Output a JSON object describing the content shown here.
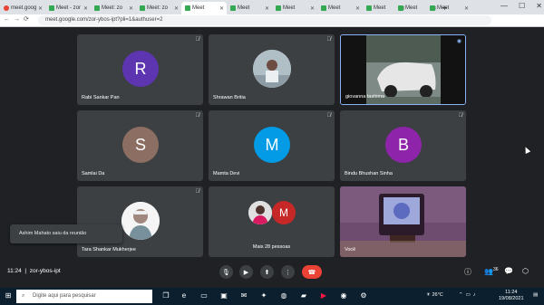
{
  "browser": {
    "tabs": [
      {
        "label": "meet.goog"
      },
      {
        "label": "Meet - zor"
      },
      {
        "label": "Meet: zo"
      },
      {
        "label": "Meet: zo"
      },
      {
        "label": "Meet"
      },
      {
        "label": "Meet"
      },
      {
        "label": "Meet"
      },
      {
        "label": "Meet"
      },
      {
        "label": "Meet"
      },
      {
        "label": "Meet"
      },
      {
        "label": "Meet"
      }
    ],
    "new_tab": "+",
    "url": "meet.google.com/zor-ybos-ipt?pli=1&authuser=2"
  },
  "participants": [
    {
      "name": "Rabi Sankar Pan",
      "initial": "R",
      "color": "#5e35b1"
    },
    {
      "name": "Shrawan Britia",
      "initial": "",
      "color": ""
    },
    {
      "name": "giovanna tashima",
      "initial": "",
      "color": ""
    },
    {
      "name": "Samlai Da",
      "initial": "S",
      "color": "#8d6e63"
    },
    {
      "name": "Mamta Devi",
      "initial": "M",
      "color": "#039be5"
    },
    {
      "name": "Bindu Bhushan Sinha",
      "initial": "B",
      "color": "#8e24aa"
    },
    {
      "name": "Tara Shankar Mukherjee",
      "initial": "",
      "color": ""
    },
    {
      "name": "Mais 28 pessoas",
      "initial": "M",
      "color": "#c62828"
    },
    {
      "name": "Você",
      "initial": "",
      "color": ""
    }
  ],
  "toast": "Ashim Mahato saiu da reunião",
  "meeting": {
    "time": "11:24",
    "code": "zor-ybos-ipt",
    "participant_count": "36"
  },
  "taskbar": {
    "search_placeholder": "Digite aqui para pesquisar",
    "weather": "26°C",
    "clock_time": "11:24",
    "clock_date": "19/08/2021"
  }
}
